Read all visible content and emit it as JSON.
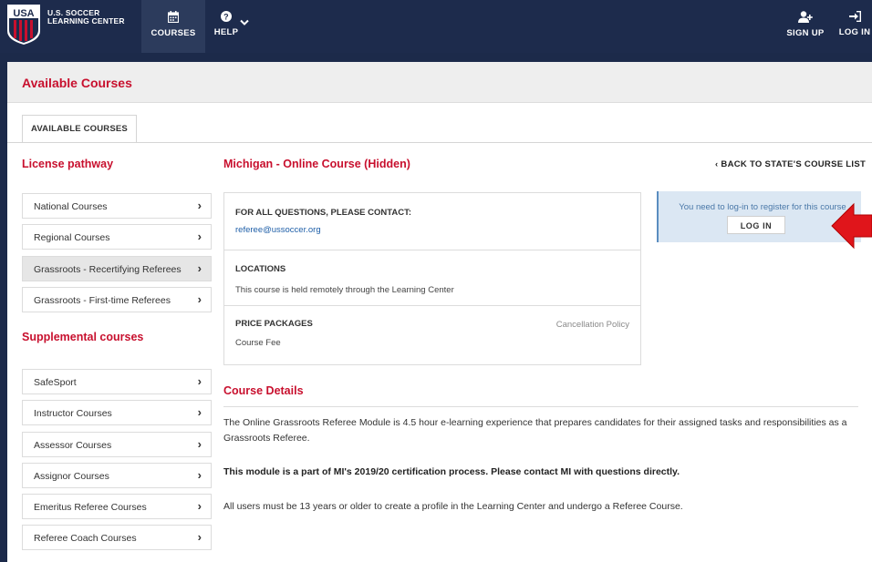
{
  "brand": {
    "line1": "U.S. SOCCER",
    "line2": "LEARNING CENTER",
    "logo_text": "USA"
  },
  "nav": {
    "courses_label": "COURSES",
    "help_label": "HELP",
    "signup_label": "SIGN UP",
    "login_label": "LOG IN"
  },
  "page": {
    "title": "Available Courses",
    "tab_label": "AVAILABLE COURSES"
  },
  "sidebar": {
    "license_title": "License pathway",
    "license_items": [
      {
        "label": "National Courses"
      },
      {
        "label": "Regional Courses"
      },
      {
        "label": "Grassroots - Recertifying Referees"
      },
      {
        "label": "Grassroots - First-time Referees"
      }
    ],
    "supplemental_title": "Supplemental courses",
    "supplemental_items": [
      {
        "label": "SafeSport"
      },
      {
        "label": "Instructor Courses"
      },
      {
        "label": "Assessor Courses"
      },
      {
        "label": "Assignor Courses"
      },
      {
        "label": "Emeritus Referee Courses"
      },
      {
        "label": "Referee Coach Courses"
      }
    ]
  },
  "course": {
    "title": "Michigan - Online Course (Hidden)",
    "back_label": "BACK TO STATE'S COURSE LIST",
    "contact_heading": "FOR ALL QUESTIONS, PLEASE CONTACT:",
    "contact_email": "referee@ussoccer.org",
    "locations_heading": "LOCATIONS",
    "locations_text": "This course is held remotely through the Learning Center",
    "price_heading": "PRICE PACKAGES",
    "cancellation_label": "Cancellation Policy",
    "price_item": "Course Fee"
  },
  "login_notice": {
    "message": "You need to log-in to register for this course",
    "button_label": "LOG IN"
  },
  "details": {
    "title": "Course Details",
    "para1": "The Online Grassroots Referee Module is 4.5 hour e-learning experience that prepares candidates for their assigned tasks and responsibilities as a Grassroots Referee.",
    "para2": "This module is a part of MI's 2019/20 certification process. Please contact MI with questions directly.",
    "para3": "All users must be 13 years or older to create a profile in the Learning Center and undergo a Referee Course."
  },
  "colors": {
    "navy": "#1d2b4c",
    "accent_red": "#c8102e",
    "link_blue": "#1f5fa8",
    "arrow_red": "#e0151b"
  }
}
